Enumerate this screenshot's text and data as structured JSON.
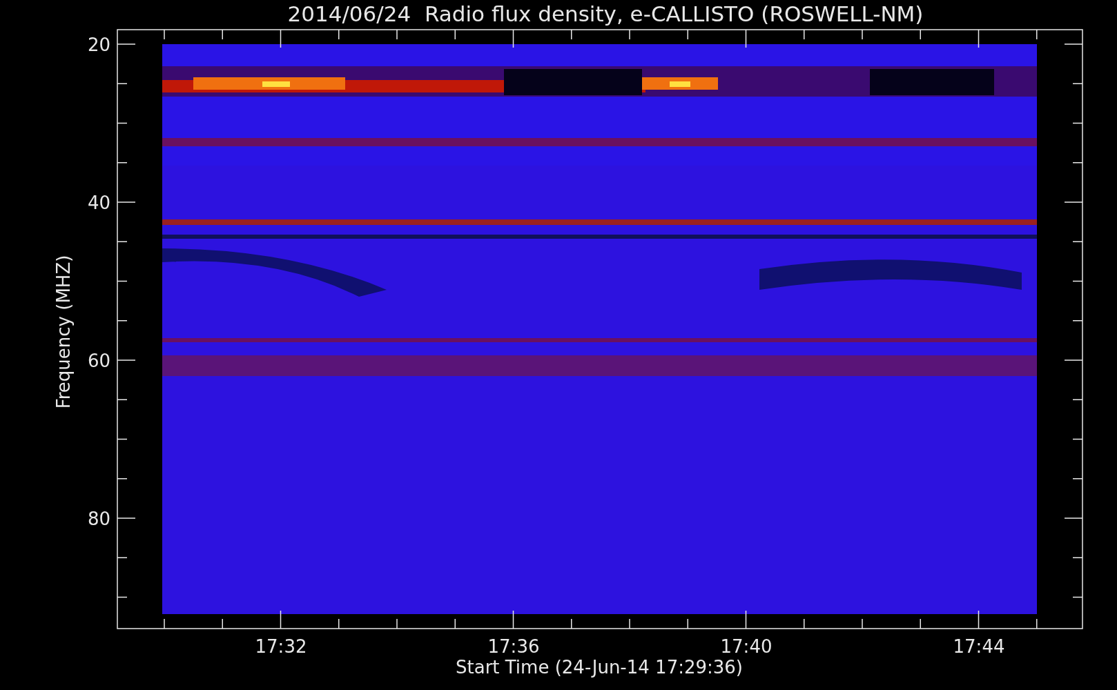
{
  "title": "2014/06/24  Radio flux density, e-CALLISTO (ROSWELL-NM)",
  "y_axis": {
    "label": "Frequency (MHZ)",
    "ticks": [
      "20",
      "40",
      "60",
      "80"
    ]
  },
  "x_axis": {
    "label": "Start Time (24-Jun-14 17:29:36)",
    "ticks": [
      "17:32",
      "17:36",
      "17:40",
      "17:44"
    ]
  }
}
